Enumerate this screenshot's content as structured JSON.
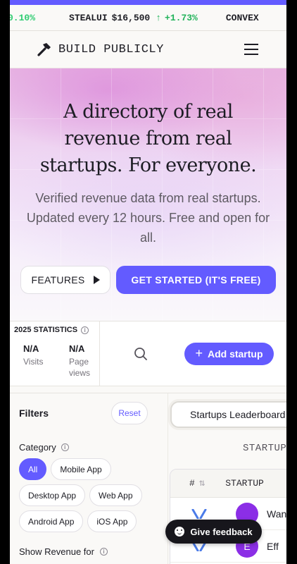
{
  "ticker": {
    "left_fragment": "0.10%",
    "name": "STEALUI",
    "price": "$16,500",
    "arrow": "↑",
    "change": "+1.73%",
    "right_fragment": "CONVEX"
  },
  "nav": {
    "logo_text": "BUILD PUBLICLY",
    "logo_icon": "hammer-icon",
    "menu_icon": "hamburger-menu-icon"
  },
  "hero": {
    "title": "A directory of real revenue from real startups. For everyone.",
    "subtitle": "Verified revenue data from real startups. Updated every 12 hours. Free and open for all.",
    "features_button": "FEATURES",
    "get_started_button": "GET STARTED (IT'S FREE)"
  },
  "stats": {
    "heading": "2025 STATISTICS",
    "info_glyph": "i",
    "visits_value": "N/A",
    "visits_label": "Visits",
    "pageviews_value": "N/A",
    "pageviews_label": "Page views",
    "add_startup_plus": "+",
    "add_startup_button": "Add startup"
  },
  "filters": {
    "title": "Filters",
    "reset_button": "Reset",
    "category_label": "Category",
    "category_info_glyph": "i",
    "categories": [
      "All",
      "Mobile App",
      "Desktop App",
      "Web App",
      "Android App",
      "iOS App"
    ],
    "selected_category": "All",
    "show_revenue_label": "Show Revenue for",
    "show_revenue_info_glyph": "i"
  },
  "leaderboard": {
    "tab_label": "Startups Leaderboard",
    "section_heading": "STARTUP",
    "columns": [
      "#",
      "STARTUP"
    ],
    "sort_icon": "sort-arrows-icon",
    "rows": [
      {
        "avatar": "",
        "name": "Wan"
      },
      {
        "avatar": "E",
        "name": "Eff"
      }
    ]
  },
  "feedback": {
    "label": "Give feedback",
    "icon": "smiley-icon"
  },
  "colors": {
    "accent": "#635bff",
    "positive": "#21b35a",
    "dark": "#17161c"
  }
}
